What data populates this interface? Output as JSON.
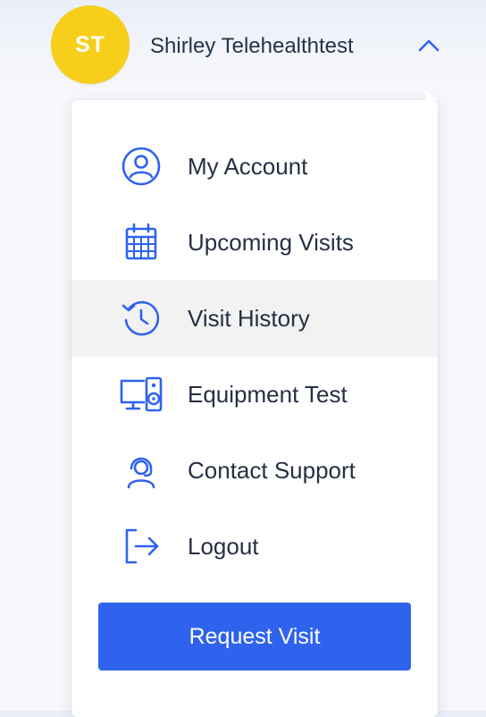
{
  "user": {
    "initials": "ST",
    "name": "Shirley Telehealthtest"
  },
  "menu": {
    "items": [
      {
        "label": "My Account",
        "icon": "user-circle-icon"
      },
      {
        "label": "Upcoming Visits",
        "icon": "calendar-icon"
      },
      {
        "label": "Visit History",
        "icon": "history-icon",
        "active": true
      },
      {
        "label": "Equipment Test",
        "icon": "monitor-speaker-icon"
      },
      {
        "label": "Contact Support",
        "icon": "headset-icon"
      },
      {
        "label": "Logout",
        "icon": "logout-icon"
      }
    ],
    "request_button": "Request Visit"
  },
  "colors": {
    "accent": "#2f63ee",
    "avatar": "#f7cf1b",
    "active_row": "#f2f2f3"
  }
}
